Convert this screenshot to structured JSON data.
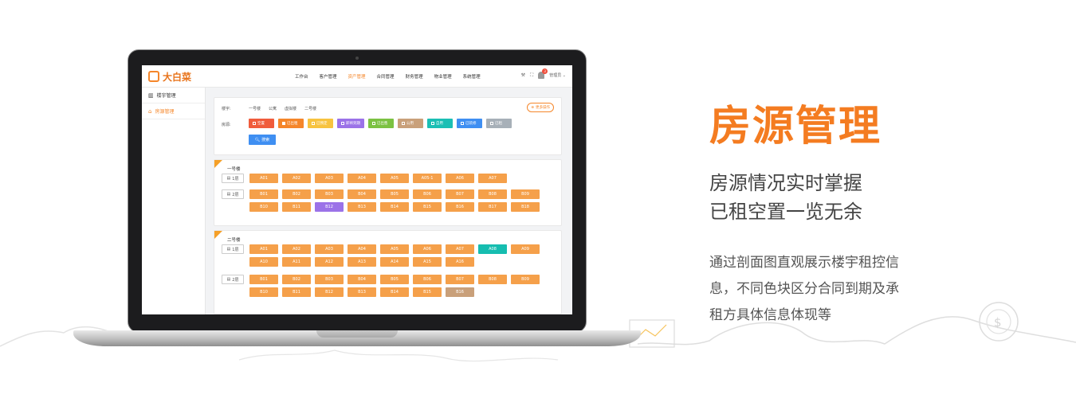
{
  "app": {
    "logo_text": "大白菜"
  },
  "nav": {
    "items": [
      "工作台",
      "客户管理",
      "资产管理",
      "合同管理",
      "财务管理",
      "物业管理",
      "系统管理"
    ],
    "active_index": 2,
    "user_label": "管理员",
    "notification_count": "3"
  },
  "sidebar": {
    "items": [
      "楼宇管理",
      "房源管理"
    ],
    "active_index": 1
  },
  "filter": {
    "building_label": "楼宇:",
    "building_options": [
      "一号楼",
      "公寓",
      "虚拟楼",
      "二号楼"
    ],
    "status_label": "房源:",
    "status_chips": [
      {
        "label": "空置",
        "color": "#f05c3c",
        "checked": false
      },
      {
        "label": "已出租",
        "color": "#f5862a",
        "checked": true
      },
      {
        "label": "已预定",
        "color": "#f7c33f",
        "checked": false
      },
      {
        "label": "即将到期",
        "color": "#9b72e8",
        "checked": false
      },
      {
        "label": "已出售",
        "color": "#7cc242",
        "checked": false
      },
      {
        "label": "公用",
        "color": "#c9a07a",
        "checked": false
      },
      {
        "label": "自用",
        "color": "#1bbfb4",
        "checked": false
      },
      {
        "label": "已装修",
        "color": "#3f8ff2",
        "checked": false
      },
      {
        "label": "已租",
        "color": "#a7b0b8",
        "checked": false
      }
    ],
    "search_label": "搜索",
    "more_label": "更多操作"
  },
  "colors": {
    "accent": "#f5862a",
    "room_default": "#f5a04a",
    "room_purple": "#9b72e8",
    "room_teal": "#16bdb0",
    "room_tan": "#c9a07a"
  },
  "buildings": [
    {
      "name": "一号楼",
      "floors": [
        {
          "label": "1层",
          "rooms": [
            {
              "n": "A01"
            },
            {
              "n": "A02"
            },
            {
              "n": "A03"
            },
            {
              "n": "A04"
            },
            {
              "n": "A05"
            },
            {
              "n": "A05-1"
            },
            {
              "n": "A06"
            },
            {
              "n": "A07"
            }
          ]
        },
        {
          "label": "2层",
          "rooms": [
            {
              "n": "B01"
            },
            {
              "n": "B02"
            },
            {
              "n": "B03"
            },
            {
              "n": "B04"
            },
            {
              "n": "B05"
            },
            {
              "n": "B06"
            },
            {
              "n": "B07"
            },
            {
              "n": "B08"
            },
            {
              "n": "B09"
            },
            {
              "n": "B10"
            },
            {
              "n": "B11"
            },
            {
              "n": "B12",
              "c": "#9b72e8"
            },
            {
              "n": "B13"
            },
            {
              "n": "B14"
            },
            {
              "n": "B15"
            },
            {
              "n": "B16"
            },
            {
              "n": "B17"
            },
            {
              "n": "B18"
            }
          ]
        }
      ]
    },
    {
      "name": "二号楼",
      "floors": [
        {
          "label": "1层",
          "rooms": [
            {
              "n": "A01"
            },
            {
              "n": "A02"
            },
            {
              "n": "A03"
            },
            {
              "n": "A04"
            },
            {
              "n": "A05"
            },
            {
              "n": "A06"
            },
            {
              "n": "A07"
            },
            {
              "n": "A08",
              "c": "#16bdb0"
            },
            {
              "n": "A09"
            },
            {
              "n": "A10"
            },
            {
              "n": "A11"
            },
            {
              "n": "A12"
            },
            {
              "n": "A13"
            },
            {
              "n": "A14"
            },
            {
              "n": "A15"
            },
            {
              "n": "A16"
            }
          ]
        },
        {
          "label": "2层",
          "rooms": [
            {
              "n": "B01"
            },
            {
              "n": "B02"
            },
            {
              "n": "B03"
            },
            {
              "n": "B04"
            },
            {
              "n": "B05"
            },
            {
              "n": "B06"
            },
            {
              "n": "B07"
            },
            {
              "n": "B08"
            },
            {
              "n": "B09"
            },
            {
              "n": "B10"
            },
            {
              "n": "B11"
            },
            {
              "n": "B12"
            },
            {
              "n": "B13"
            },
            {
              "n": "B14"
            },
            {
              "n": "B15"
            },
            {
              "n": "B16",
              "c": "#c9a07a"
            }
          ]
        }
      ]
    }
  ],
  "hero": {
    "title": "房源管理",
    "subtitle_lines": [
      "房源情况实时掌握",
      "已租空置一览无余"
    ],
    "desc_lines": [
      "通过剖面图直观展示楼宇租控信",
      "息，不同色块区分合同到期及承",
      "租方具体信息体现等"
    ]
  }
}
